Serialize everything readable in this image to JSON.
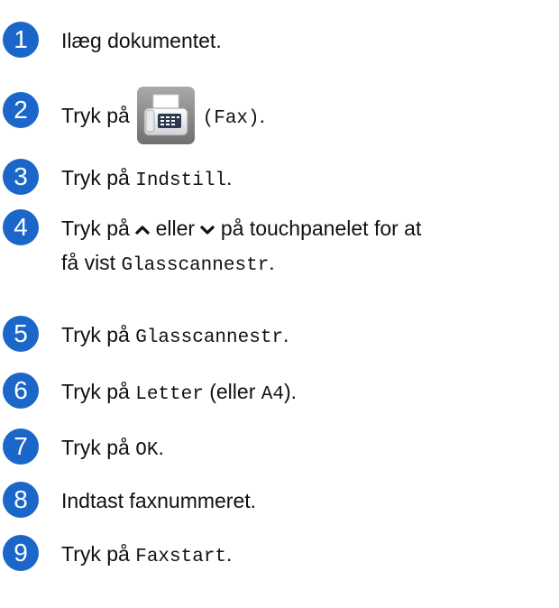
{
  "accent_color": "#1a67c9",
  "steps": [
    {
      "num": "1",
      "text": "Ilæg dokumentet."
    },
    {
      "num": "2",
      "pre": "Tryk på",
      "code": "(Fax)",
      "icon": "fax-icon"
    },
    {
      "num": "3",
      "pre": "Tryk på",
      "code": "Indstill",
      "post": "."
    },
    {
      "num": "4",
      "pre": "Tryk på",
      "mid1": "eller",
      "mid2": "på touchpanelet for at",
      "line2_pre": "få vist",
      "code": "Glasscannestr",
      "post": "."
    },
    {
      "num": "5",
      "pre": "Tryk på",
      "code": "Glasscannestr",
      "post": "."
    },
    {
      "num": "6",
      "pre": "Tryk på",
      "code": "Letter",
      "mid": "(eller",
      "code2": "A4",
      "post": ")."
    },
    {
      "num": "7",
      "pre": "Tryk på",
      "code": "OK",
      "post": "."
    },
    {
      "num": "8",
      "text": "Indtast faxnummeret."
    },
    {
      "num": "9",
      "pre": "Tryk på",
      "code": "Faxstart",
      "post": "."
    }
  ]
}
